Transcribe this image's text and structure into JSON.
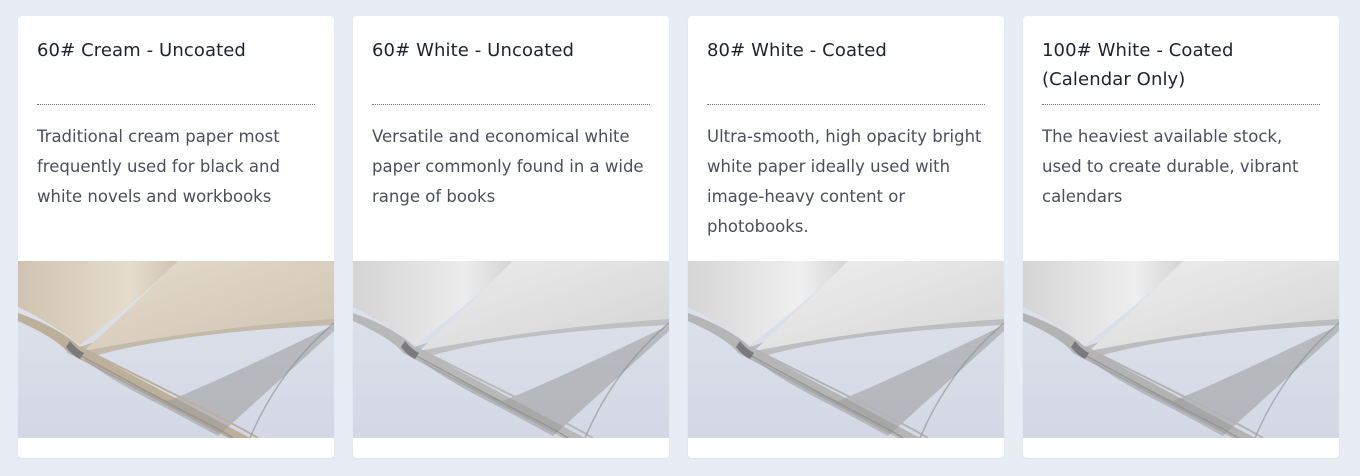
{
  "paper_options": [
    {
      "title": "60# Cream - Uncoated",
      "description": "Traditional cream paper most frequently used for black and white novels and workbooks",
      "paper_color": "#e6dccd",
      "paper_shade": "#cfc3b0",
      "edge_color": "#bdb09b"
    },
    {
      "title": "60# White - Uncoated",
      "description": "Versatile and economical white paper commonly found in a wide range of books",
      "paper_color": "#ececec",
      "paper_shade": "#d4d4d4",
      "edge_color": "#b8b8b8"
    },
    {
      "title": "80# White - Coated",
      "description": "Ultra-smooth, high opacity bright white paper ideally used with image-heavy content or photobooks.",
      "paper_color": "#efefef",
      "paper_shade": "#d6d6d6",
      "edge_color": "#b5b5b5"
    },
    {
      "title": "100# White - Coated (Calendar Only)",
      "description": "The heaviest available stock, used to create durable, vibrant calendars",
      "paper_color": "#eeeeee",
      "paper_shade": "#d5d5d5",
      "edge_color": "#b3b3b3"
    }
  ]
}
